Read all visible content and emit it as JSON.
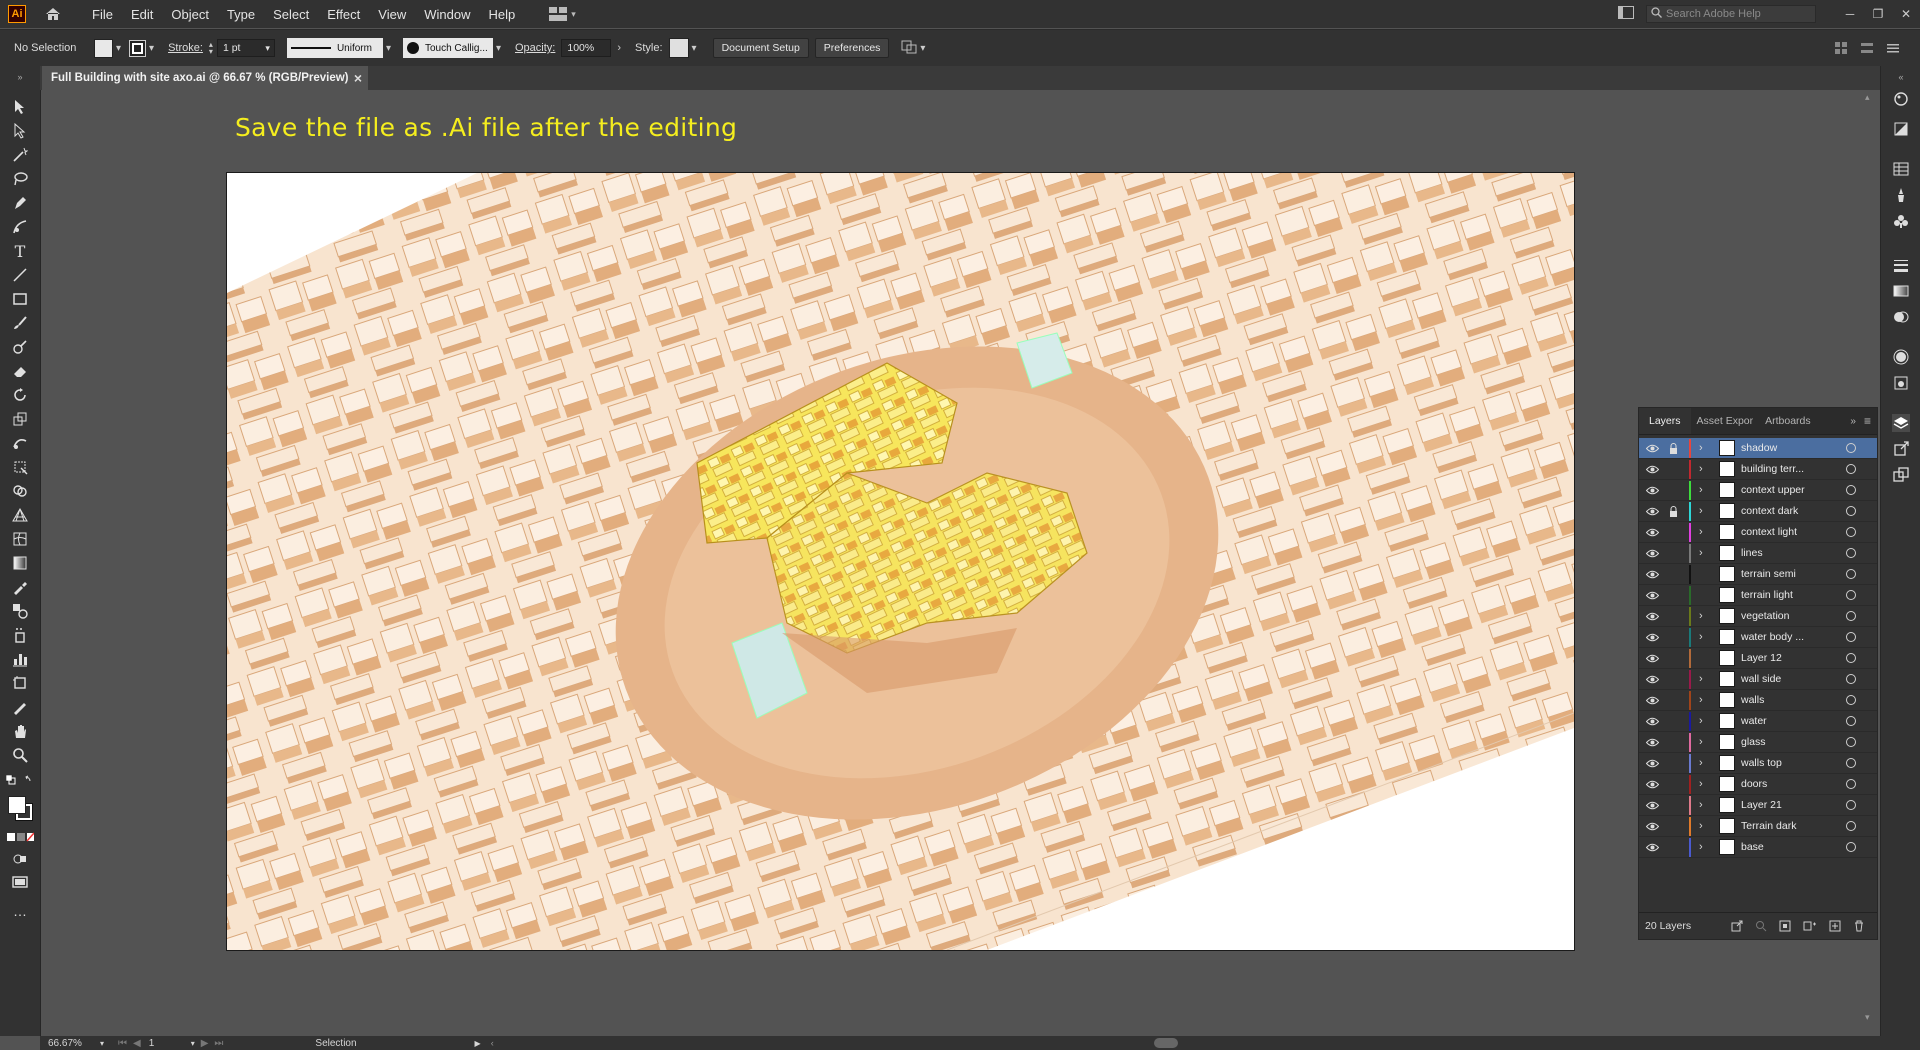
{
  "menubar": {
    "app_icon": "Ai",
    "items": [
      "File",
      "Edit",
      "Object",
      "Type",
      "Select",
      "Effect",
      "View",
      "Window",
      "Help"
    ],
    "search_placeholder": "Search Adobe Help"
  },
  "controlbar": {
    "selection_status": "No Selection",
    "stroke_label": "Stroke:",
    "stroke_weight": "1 pt",
    "profile_label": "Uniform",
    "brush_label": "Touch Callig...",
    "opacity_label": "Opacity:",
    "opacity_value": "100%",
    "style_label": "Style:",
    "document_setup_button": "Document Setup",
    "preferences_button": "Preferences"
  },
  "document": {
    "tab_title": "Full Building with site axo.ai @ 66.67 % (RGB/Preview)",
    "close_glyph": "×"
  },
  "canvas": {
    "note_text": "Save the file as .Ai file after the editing"
  },
  "layers_panel": {
    "tabs": [
      "Layers",
      "Asset Expor",
      "Artboards"
    ],
    "layers": [
      {
        "name": "shadow",
        "color": "#e8453c",
        "locked": true,
        "expandable": true,
        "selected": true
      },
      {
        "name": "building terr...",
        "color": "#c0282f",
        "locked": false,
        "expandable": true,
        "selected": false
      },
      {
        "name": "context upper",
        "color": "#3ddc3d",
        "locked": false,
        "expandable": true,
        "selected": false
      },
      {
        "name": "context dark",
        "color": "#2ed7d7",
        "locked": true,
        "expandable": true,
        "selected": false
      },
      {
        "name": "context light",
        "color": "#e040e0",
        "locked": false,
        "expandable": true,
        "selected": false
      },
      {
        "name": "lines",
        "color": "#7a7a7a",
        "locked": false,
        "expandable": true,
        "selected": false
      },
      {
        "name": "terrain semi",
        "color": "#111111",
        "locked": false,
        "expandable": false,
        "selected": false
      },
      {
        "name": "terrain light",
        "color": "#2a6a2a",
        "locked": false,
        "expandable": false,
        "selected": false
      },
      {
        "name": "vegetation",
        "color": "#6a7a1a",
        "locked": false,
        "expandable": true,
        "selected": false
      },
      {
        "name": "water body ...",
        "color": "#1a7a7a",
        "locked": false,
        "expandable": true,
        "selected": false
      },
      {
        "name": "Layer 12",
        "color": "#b26a3a",
        "locked": false,
        "expandable": false,
        "selected": false
      },
      {
        "name": "wall side",
        "color": "#9a1a4a",
        "locked": false,
        "expandable": true,
        "selected": false
      },
      {
        "name": "walls",
        "color": "#a0441a",
        "locked": false,
        "expandable": true,
        "selected": false
      },
      {
        "name": "water",
        "color": "#1a1aa0",
        "locked": false,
        "expandable": true,
        "selected": false
      },
      {
        "name": "glass",
        "color": "#e06aa0",
        "locked": false,
        "expandable": true,
        "selected": false
      },
      {
        "name": "walls top",
        "color": "#6a7ad0",
        "locked": false,
        "expandable": true,
        "selected": false
      },
      {
        "name": "doors",
        "color": "#a02020",
        "locked": false,
        "expandable": true,
        "selected": false
      },
      {
        "name": "Layer 21",
        "color": "#e07a8a",
        "locked": false,
        "expandable": true,
        "selected": false
      },
      {
        "name": "Terrain dark",
        "color": "#e07a2a",
        "locked": false,
        "expandable": true,
        "selected": false
      },
      {
        "name": "base",
        "color": "#4a5ad0",
        "locked": false,
        "expandable": true,
        "selected": false
      }
    ],
    "layer_count": "20 Layers"
  },
  "statusbar": {
    "zoom": "66.67%",
    "artboard_number": "1",
    "tool_name": "Selection"
  },
  "colors": {
    "ui_dark": "#323232",
    "canvas_bg": "#535353",
    "note_yellow": "#f5ee1e",
    "selected_row": "#4b6ea0",
    "context_buildings": "#f6dcc3",
    "building_highlight": "#f8e35a"
  }
}
